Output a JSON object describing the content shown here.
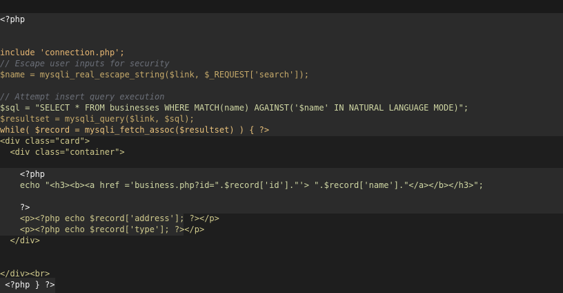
{
  "editor": {
    "lines": [
      "<?php",
      "",
      "",
      "include 'connection.php';",
      "// Escape user inputs for security",
      "$name = mysqli_real_escape_string($link, $_REQUEST['search']);",
      "",
      "// Attempt insert query execution",
      "$sql = \"SELECT * FROM businesses WHERE MATCH(name) AGAINST('$name' IN NATURAL LANGUAGE MODE)\";",
      "$resultset = mysqli_query($link, $sql);",
      "while( $record = mysqli_fetch_assoc($resultset) ) { ?>",
      "<div class=\"card\">",
      "  <div class=\"container\">",
      "",
      "    <?php",
      "    echo \"<h3><b><a href ='business.php?id=\".$record['id'].\"'> \".$record['name'].\"</a></b></h3>\";",
      "",
      "    ?>",
      "    <p><?php echo $record['address']; ?></p>",
      "    <p><?php echo $record['type']; ?></p>",
      "  </div>",
      "",
      "",
      "</div><br>",
      " <?php } ?>"
    ]
  }
}
